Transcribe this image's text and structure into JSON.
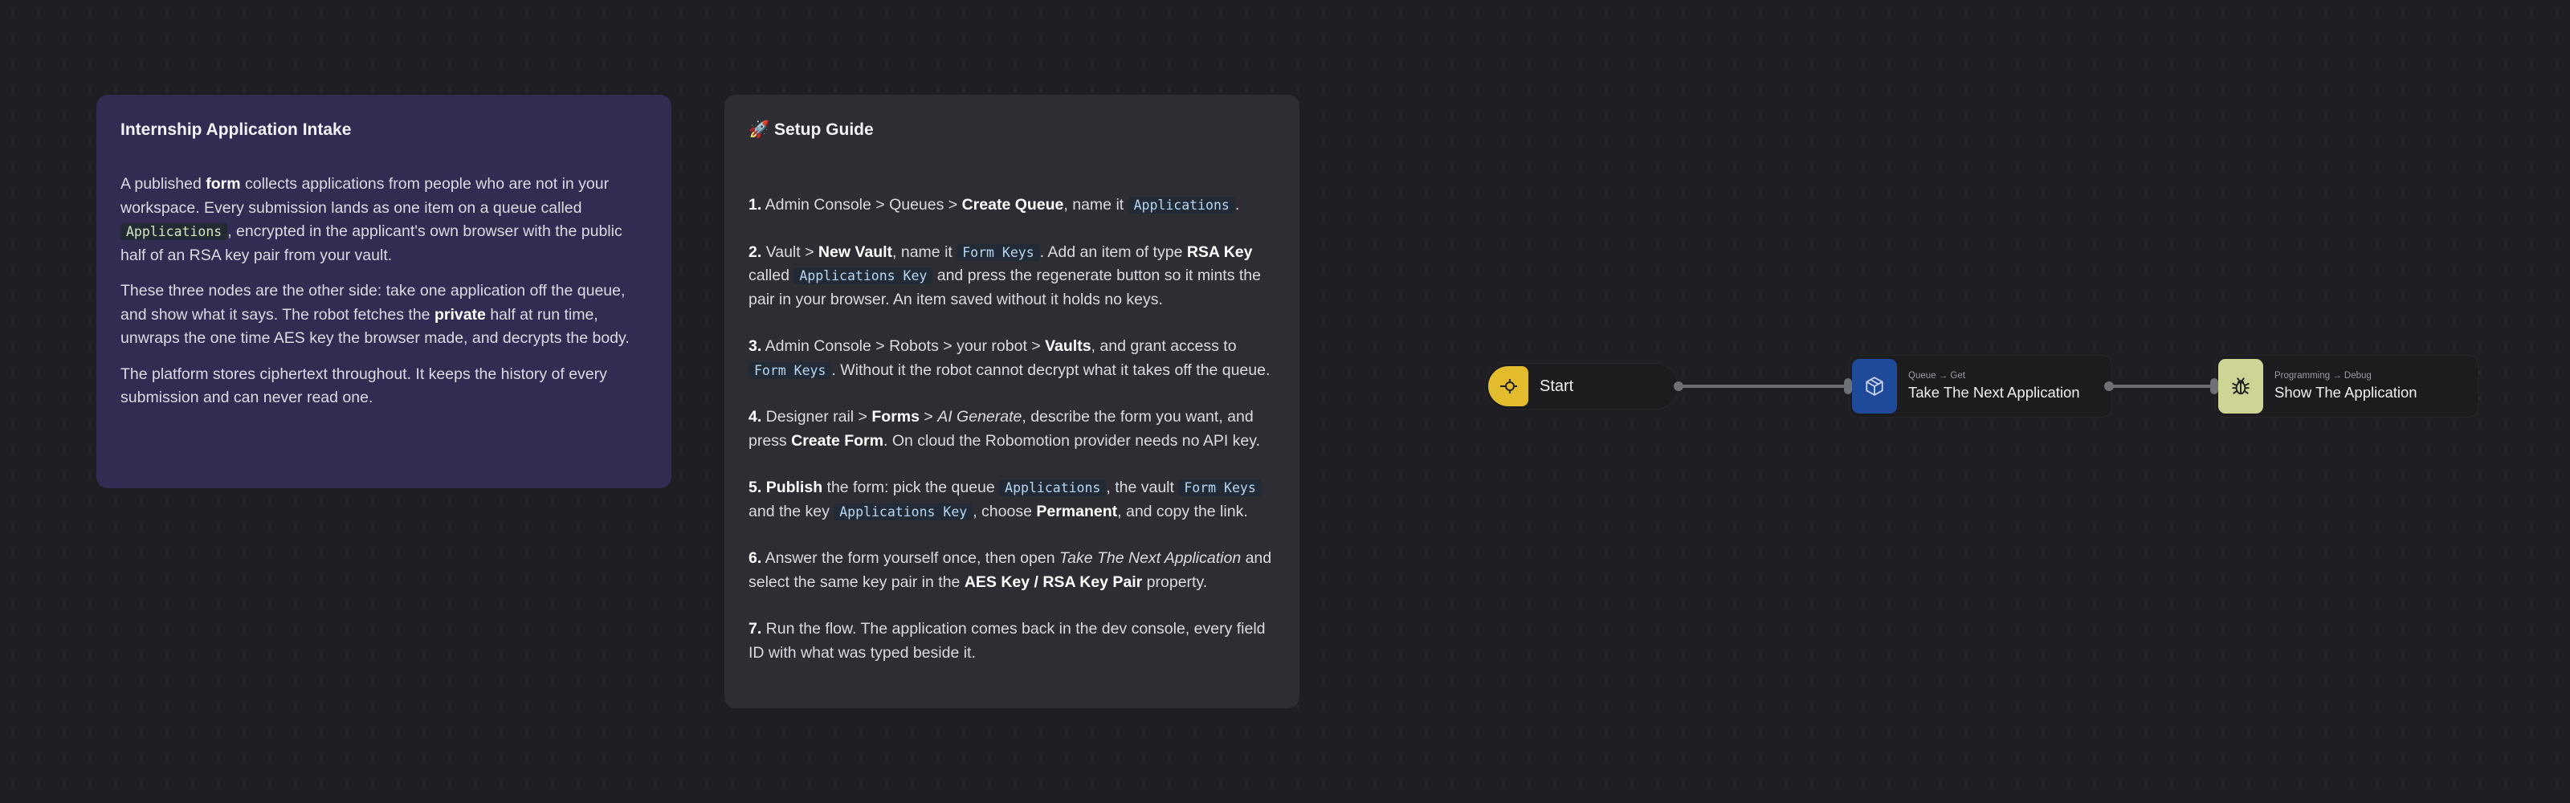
{
  "intro_note": {
    "title": "Internship Application Intake",
    "p1": {
      "t1": "A published ",
      "b1": "form",
      "t2": " collects applications from people who are not in your workspace. Every submission lands as one item on a queue called ",
      "c1": "Applications",
      "t3": ", encrypted in the applicant's own browser with the public half of an RSA key pair from your vault."
    },
    "p2": {
      "t1": "These three nodes are the other side: take one application off the queue, and show what it says. The robot fetches the ",
      "b1": "private",
      "t2": " half at run time, unwraps the one time AES key the browser made, and decrypts the body."
    },
    "p3": "The platform stores ciphertext throughout. It keeps the history of every submission and can never read one."
  },
  "guide_note": {
    "title": "🚀 Setup Guide",
    "steps": [
      {
        "num": "1.",
        "t1": " Admin Console > Queues > ",
        "b1": "Create Queue",
        "t2": ", name it ",
        "c1": "Applications",
        "t3": "."
      },
      {
        "num": "2.",
        "t1": " Vault > ",
        "b1": "New Vault",
        "t2": ", name it ",
        "c1": "Form Keys",
        "t3": ". Add an item of type ",
        "b2": "RSA Key",
        "t4": " called ",
        "c2": "Applications Key",
        "t5": " and press the regenerate button so it mints the pair in your browser. An item saved without it holds no keys."
      },
      {
        "num": "3.",
        "t1": " Admin Console > Robots > your robot > ",
        "b1": "Vaults",
        "t2": ", and grant access to ",
        "c1": "Form Keys",
        "t3": ". Without it the robot cannot decrypt what it takes off the queue."
      },
      {
        "num": "4.",
        "t1": " Designer rail > ",
        "b1": "Forms",
        "t2": " > ",
        "i1": "AI Generate",
        "t3": ", describe the form you want, and press ",
        "b2": "Create Form",
        "t4": ". On cloud the Robomotion provider needs no API key."
      },
      {
        "num": "5.",
        "b1": "Publish",
        "t1": " the form: pick the queue ",
        "c1": "Applications",
        "t2": ", the vault ",
        "c2": "Form Keys",
        "t3": " and the key ",
        "c3": "Applications Key",
        "t4": ", choose ",
        "b2": "Permanent",
        "t5": ", and copy the link."
      },
      {
        "num": "6.",
        "t1": " Answer the form yourself once, then open ",
        "i1": "Take The Next Application",
        "t2": " and select the same key pair in the ",
        "b1": "AES Key / RSA Key Pair",
        "t3": " property."
      },
      {
        "num": "7.",
        "t1": " Run the flow. The application comes back in the dev console, every field ID with what was typed beside it."
      }
    ]
  },
  "flow": {
    "start": {
      "label": "Start",
      "icon": "start-icon",
      "color": "#e2bc2c"
    },
    "queue_get": {
      "category": "Queue → Get",
      "label": "Take The Next Application",
      "icon": "cube-icon",
      "color": "#1f4a9a"
    },
    "debug": {
      "category": "Programming → Debug",
      "label": "Show The Application",
      "icon": "bug-icon",
      "color": "#cdd496"
    }
  },
  "colors": {
    "background": "#1f1e23",
    "intro_note": "#332c52",
    "guide_note": "#2e2d33"
  }
}
